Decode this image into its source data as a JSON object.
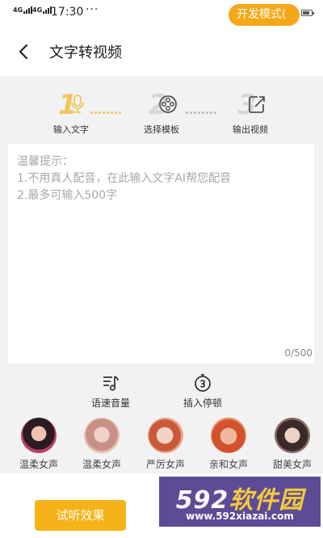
{
  "status_bar": {
    "signal_1": "4G",
    "signal_2": "4G",
    "time": "17:30",
    "more": "···",
    "dev_mode_label": "开发模式("
  },
  "header": {
    "title": "文字转视频"
  },
  "steps": [
    {
      "number": "1",
      "label": "输入文字",
      "icon": "microphone-icon",
      "active": true
    },
    {
      "number": "2",
      "label": "选择模板",
      "icon": "film-reel-icon",
      "active": false
    },
    {
      "number": "3",
      "label": "输出视频",
      "icon": "export-icon",
      "active": false
    }
  ],
  "input": {
    "placeholder": "温馨提示：\n1.不用真人配音，在此输入文字AI帮您配音\n2.最多可输入500字",
    "counter": "0/500"
  },
  "tools": [
    {
      "label": "语速音量",
      "icon": "music-note-icon"
    },
    {
      "label": "插入停顿",
      "icon": "pause-timer-icon"
    }
  ],
  "voices": [
    {
      "label": "温柔女声"
    },
    {
      "label": "温柔女声"
    },
    {
      "label": "严厉女声"
    },
    {
      "label": "亲和女声"
    },
    {
      "label": "甜美女声"
    }
  ],
  "bottom": {
    "preview_label": "试听效果"
  },
  "watermark": {
    "brand_num": "592",
    "brand_cn": "软件园",
    "url": "www.592xiazai.com"
  },
  "colors": {
    "accent": "#f6b219",
    "step_active": "#f3c35c",
    "background": "#f2f2f2",
    "watermark_bg": "#5d4b96"
  }
}
